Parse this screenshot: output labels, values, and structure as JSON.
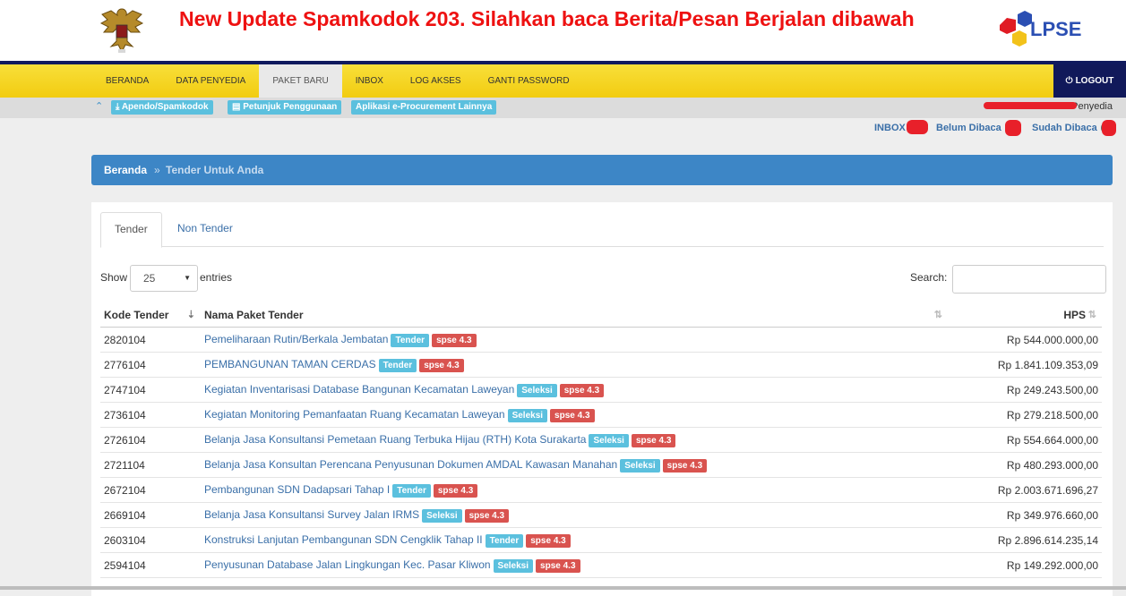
{
  "header": {
    "announcement": "New Update Spamkodok 203. Silahkan baca Berita/Pesan Berjalan dibawah",
    "logo_text": "LPSE"
  },
  "nav": {
    "items": [
      "BERANDA",
      "DATA PENYEDIA",
      "PAKET BARU",
      "INBOX",
      "LOG AKSES",
      "GANTI PASSWORD"
    ],
    "active": "PAKET BARU",
    "logout": "LOGOUT"
  },
  "subbar": {
    "buttons": [
      "Apendo/Spamkodok",
      "Petunjuk Penggunaan",
      "Aplikasi e-Procurement Lainnya"
    ],
    "user_suffix": "Penyedia"
  },
  "inbox": {
    "inbox": "INBOX",
    "unread": "Belum Dibaca",
    "read": "Sudah Dibaca"
  },
  "breadcrumb": {
    "home": "Beranda",
    "sep": "»",
    "current": "Tender Untuk Anda"
  },
  "tabs": [
    "Tender",
    "Non Tender"
  ],
  "table_controls": {
    "show": "Show",
    "entries_value": "25",
    "entries": "entries",
    "search": "Search:"
  },
  "table": {
    "headers": [
      "Kode Tender",
      "Nama Paket Tender",
      "HPS"
    ],
    "rows": [
      {
        "kode": "2820104",
        "nama": "Pemeliharaan Rutin/Berkala Jembatan",
        "tipe": "Tender",
        "versi": "spse 4.3",
        "hps": "Rp 544.000.000,00"
      },
      {
        "kode": "2776104",
        "nama": "PEMBANGUNAN TAMAN CERDAS",
        "tipe": "Tender",
        "versi": "spse 4.3",
        "hps": "Rp 1.841.109.353,09"
      },
      {
        "kode": "2747104",
        "nama": "Kegiatan Inventarisasi Database Bangunan Kecamatan Laweyan",
        "tipe": "Seleksi",
        "versi": "spse 4.3",
        "hps": "Rp 249.243.500,00"
      },
      {
        "kode": "2736104",
        "nama": "Kegiatan Monitoring Pemanfaatan Ruang Kecamatan Laweyan",
        "tipe": "Seleksi",
        "versi": "spse 4.3",
        "hps": "Rp 279.218.500,00"
      },
      {
        "kode": "2726104",
        "nama": "Belanja Jasa Konsultansi Pemetaan Ruang Terbuka Hijau (RTH) Kota Surakarta",
        "tipe": "Seleksi",
        "versi": "spse 4.3",
        "hps": "Rp 554.664.000,00"
      },
      {
        "kode": "2721104",
        "nama": "Belanja Jasa Konsultan Perencana Penyusunan Dokumen AMDAL Kawasan Manahan",
        "tipe": "Seleksi",
        "versi": "spse 4.3",
        "hps": "Rp 480.293.000,00"
      },
      {
        "kode": "2672104",
        "nama": "Pembangunan SDN Dadapsari Tahap I",
        "tipe": "Tender",
        "versi": "spse 4.3",
        "hps": "Rp 2.003.671.696,27"
      },
      {
        "kode": "2669104",
        "nama": "Belanja Jasa Konsultansi Survey Jalan IRMS",
        "tipe": "Seleksi",
        "versi": "spse 4.3",
        "hps": "Rp 349.976.660,00"
      },
      {
        "kode": "2603104",
        "nama": "Konstruksi Lanjutan Pembangunan SDN Cengklik Tahap II",
        "tipe": "Tender",
        "versi": "spse 4.3",
        "hps": "Rp 2.896.614.235,14"
      },
      {
        "kode": "2594104",
        "nama": "Penyusunan Database Jalan Lingkungan Kec. Pasar Kliwon",
        "tipe": "Seleksi",
        "versi": "spse 4.3",
        "hps": "Rp 149.292.000,00"
      }
    ]
  },
  "colors": {
    "nav_yellow": "#f5d424",
    "dark_blue": "#11195a",
    "breadcrumb_blue": "#3d86c6",
    "label_info": "#5bc0de",
    "label_danger": "#d9534f",
    "announcement_red": "#ee1111"
  }
}
